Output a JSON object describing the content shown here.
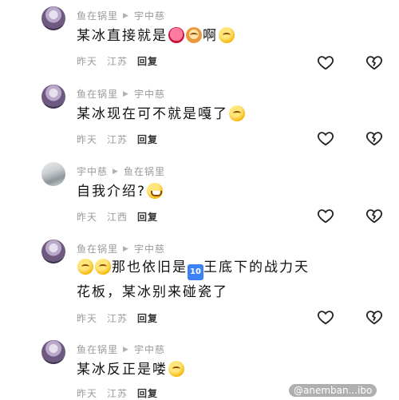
{
  "comments": [
    {
      "author": "鱼在锅里",
      "reply_to": "宇中慈",
      "segments": [
        "某冰直接就是",
        "",
        "",
        "啊",
        ""
      ],
      "line2": "",
      "time": "昨天",
      "location": "江苏",
      "reply_label": "回复"
    },
    {
      "author": "鱼在锅里",
      "reply_to": "宇中慈",
      "segments": [
        "某冰现在可不就是嘎了"
      ],
      "line2": "",
      "time": "昨天",
      "location": "江苏",
      "reply_label": "回复"
    },
    {
      "author": "宇中慈",
      "reply_to": "鱼在锅里",
      "segments": [
        "自我介绍?"
      ],
      "line2": "",
      "time": "昨天",
      "location": "江西",
      "reply_label": "回复"
    },
    {
      "author": "鱼在锅里",
      "reply_to": "宇中慈",
      "segments": [
        "那也依旧是",
        "王底下的战力天"
      ],
      "line2": "花板，某冰别来碰瓷了",
      "ten_badge": "10",
      "time": "昨天",
      "location": "江苏",
      "reply_label": "回复"
    },
    {
      "author": "鱼在锅里",
      "reply_to": "宇中慈",
      "segments": [
        "某冰反正是喽"
      ],
      "line2": "",
      "time": "昨天",
      "location": "江苏",
      "reply_label": "回复"
    }
  ],
  "icons": {
    "like": "heart-icon",
    "dislike": "broken-heart-icon",
    "arrow": "play-triangle-icon"
  },
  "watermark": "@anemban...ibo"
}
